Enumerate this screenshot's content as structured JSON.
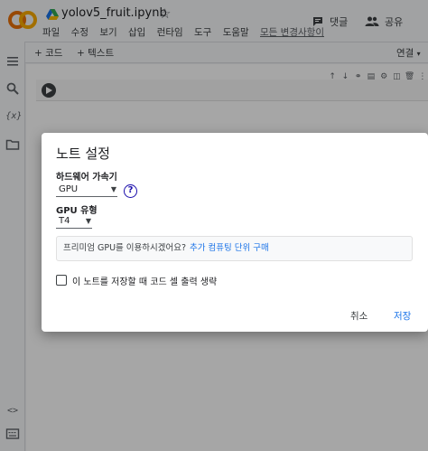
{
  "header": {
    "notebook_title": "yolov5_fruit.ipynb",
    "menu": [
      "파일",
      "수정",
      "보기",
      "삽입",
      "런타임",
      "도구",
      "도움말"
    ],
    "changes_link": "모든 변경사항이",
    "comment_label": "댓글",
    "share_label": "공유"
  },
  "toolbar": {
    "add_code": "+ 코드",
    "add_text": "+ 텍스트",
    "connect": "연결"
  },
  "dialog": {
    "title": "노트 설정",
    "hardware_label": "하드웨어 가속기",
    "hardware_value": "GPU",
    "gpu_type_label": "GPU 유형",
    "gpu_type_value": "T4",
    "promo_text": "프리미엄 GPU를 이용하시겠어요?",
    "promo_link": "추가 컴퓨팅 단위 구매",
    "checkbox_label": "이 노트를 저장할 때 코드 셀 출력 생략",
    "cancel_label": "취소",
    "save_label": "저장"
  },
  "colors": {
    "logo_orange": "#f9ab00",
    "logo_dark_orange": "#e8710a",
    "link_blue": "#1a73e8",
    "help_blue": "#1a0dab"
  },
  "icons": {
    "sidebar": [
      "toc-icon",
      "search-icon",
      "variables-icon",
      "folder-icon",
      "code-snippets-icon",
      "terminal-icon"
    ],
    "cell_toolbar": [
      "arrow-up-icon",
      "arrow-down-icon",
      "link-icon",
      "comment-icon",
      "settings-icon",
      "mirror-icon",
      "delete-icon",
      "more-icon"
    ]
  }
}
